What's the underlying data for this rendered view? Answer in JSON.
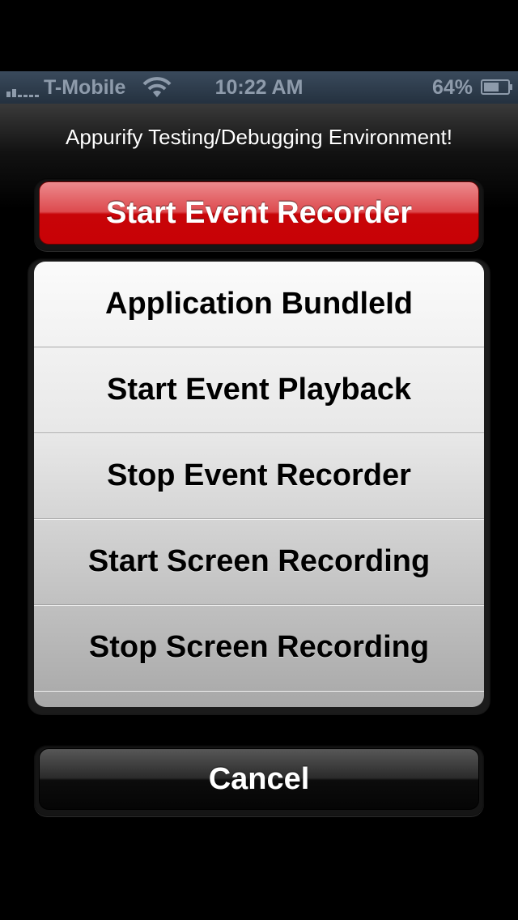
{
  "status_bar": {
    "carrier": "T-Mobile",
    "time": "10:22 AM",
    "battery_percent": "64%",
    "battery_level": 0.64
  },
  "sheet": {
    "title": "Appurify Testing/Debugging Environment!",
    "primary_button": "Start Event Recorder",
    "options": [
      "Application BundleId",
      "Start Event Playback",
      "Stop Event Recorder",
      "Start Screen Recording",
      "Stop Screen Recording"
    ],
    "cancel_button": "Cancel"
  },
  "colors": {
    "primary_red": "#c80205",
    "status_bar_bg": "#2e3b4a",
    "status_text": "#8e9bab"
  },
  "icons": [
    "signal-strength-icon",
    "wifi-icon",
    "battery-icon"
  ]
}
